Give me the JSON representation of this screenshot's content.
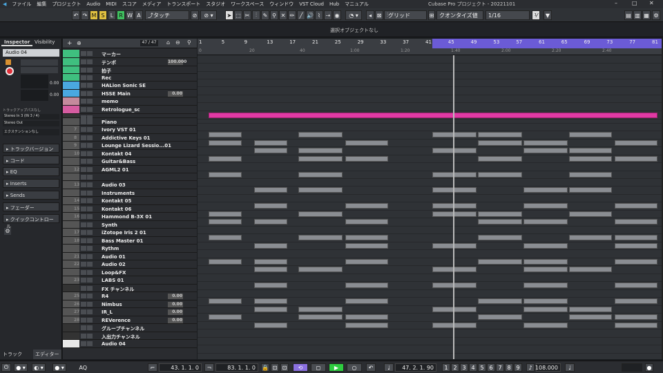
{
  "menu": [
    "ファイル",
    "編集",
    "プロジェクト",
    "Audio",
    "MIDI",
    "スコア",
    "メディア",
    "トランスポート",
    "スタジオ",
    "ワークスペース",
    "ウィンドウ",
    "VST Cloud",
    "Hub",
    "マニュアル"
  ],
  "window_title": "Cubase Pro プロジェクト - 20221101",
  "toolbar": {
    "m": "M",
    "s": "S",
    "l": "L",
    "r": "R",
    "w": "W",
    "a": "A",
    "automation_mode": "タッチ",
    "snap_type": "グリッド",
    "quantize_preset": "クオンタイズ値",
    "quantize_value": "1/16"
  },
  "info_line": "選択オブジェクトなし",
  "inspector": {
    "tab_inspector": "Inspector",
    "tab_visibility": "Visibility",
    "track_name": "Audio 04",
    "vol": "0.00",
    "pan": "0.00",
    "routing_label": "トラックアップパスなし",
    "input": "Stereo In 3 (IN 3 / 4)",
    "output": "Stereo Out",
    "ext": "エクステンションなし",
    "sections": [
      "トラックバージョン",
      "コード",
      "EQ",
      "Inserts",
      "Sends",
      "フェーダー",
      "クイックコントロール"
    ],
    "bottom_tab1": "トラック",
    "bottom_tab2": "エディター"
  },
  "track_counter": "47 / 47",
  "tracks": [
    {
      "name": "マーカー",
      "color": "#3fbf7f",
      "h": 12
    },
    {
      "name": "テンポ",
      "color": "#3fbf7f",
      "h": 12,
      "val": "100.000"
    },
    {
      "name": "拍子",
      "color": "#3fbf7f",
      "h": 11
    },
    {
      "name": "Rec",
      "color": "#3fbf7f",
      "h": 11
    },
    {
      "name": "HALion Sonic SE",
      "color": "#4aa8e0",
      "h": 12
    },
    {
      "name": "HSSE Main",
      "color": "#4aa8e0",
      "h": 11,
      "val": "0.00"
    },
    {
      "name": "memo",
      "color": "#c48a9c",
      "h": 12
    },
    {
      "name": "Retrologue_sc",
      "color": "#d65ca0",
      "h": 12
    },
    {
      "name": "",
      "color": "#333",
      "h": 6
    },
    {
      "name": "Piano",
      "color": "#555",
      "h": 11
    },
    {
      "name": "Ivory VST 01",
      "num": "7",
      "color": "#555",
      "h": 12
    },
    {
      "name": "Addictive Keys 01",
      "num": "8",
      "color": "#555",
      "h": 11
    },
    {
      "name": "Lounge Lizard Sessio...01",
      "num": "9",
      "color": "#555",
      "h": 12
    },
    {
      "name": "Kontakt 04",
      "num": "10",
      "color": "#555",
      "h": 11
    },
    {
      "name": "Guitar&Bass",
      "color": "#555",
      "h": 12
    },
    {
      "name": "AGML2 01",
      "num": "12",
      "color": "#555",
      "h": 11
    },
    {
      "name": "",
      "color": "#555",
      "h": 11
    },
    {
      "name": "Audio 03",
      "num": "13",
      "color": "#555",
      "h": 12
    },
    {
      "name": "Instruments",
      "color": "#555",
      "h": 11
    },
    {
      "name": "Kontakt 05",
      "num": "14",
      "color": "#555",
      "h": 12
    },
    {
      "name": "Kontakt 06",
      "num": "15",
      "color": "#555",
      "h": 11
    },
    {
      "name": "Hammond B-3X 01",
      "num": "16",
      "color": "#555",
      "h": 12
    },
    {
      "name": "Synth",
      "color": "#555",
      "h": 11
    },
    {
      "name": "iZotope Iris 2 01",
      "num": "17",
      "color": "#555",
      "h": 12
    },
    {
      "name": "Bass Master 01",
      "num": "18",
      "color": "#555",
      "h": 11
    },
    {
      "name": "Rythm",
      "color": "#555",
      "h": 12
    },
    {
      "name": "Audio 01",
      "num": "21",
      "color": "#555",
      "h": 11
    },
    {
      "name": "Audio 02",
      "num": "22",
      "color": "#555",
      "h": 12
    },
    {
      "name": "Loop&FX",
      "color": "#555",
      "h": 11
    },
    {
      "name": "LABS 01",
      "num": "23",
      "color": "#555",
      "h": 12
    },
    {
      "name": "FX チャンネル",
      "color": "#333",
      "h": 11
    },
    {
      "name": "R4",
      "num": "25",
      "color": "#555",
      "h": 12,
      "val": "0.00"
    },
    {
      "name": "Nimbus",
      "num": "26",
      "color": "#555",
      "h": 11,
      "val": "0.00"
    },
    {
      "name": "IR_L",
      "num": "27",
      "color": "#555",
      "h": 12,
      "val": "0.00"
    },
    {
      "name": "REVerence",
      "num": "28",
      "color": "#555",
      "h": 11,
      "val": "0.00"
    },
    {
      "name": "グループチャンネル",
      "color": "#333",
      "h": 12
    },
    {
      "name": "入出力チャンネル",
      "color": "#333",
      "h": 11
    },
    {
      "name": "Audio 04",
      "color": "#e8e8e8",
      "h": 12
    }
  ],
  "ruler_bars": [
    "1",
    "5",
    "9",
    "13",
    "17",
    "21",
    "25",
    "29",
    "33",
    "37",
    "41",
    "45",
    "49",
    "53",
    "57",
    "61",
    "65",
    "69",
    "73",
    "77",
    "81"
  ],
  "ruler_times": [
    "0",
    "20",
    "40",
    "1:00",
    "1:20",
    "1:40",
    "2:00",
    "2:20",
    "2:40"
  ],
  "transport": {
    "left_locator": "43. 1. 1. 0",
    "right_locator": "83. 1. 1. 0",
    "position": "47. 2. 1. 90",
    "tempo": "108.000",
    "aq": "AQ"
  }
}
